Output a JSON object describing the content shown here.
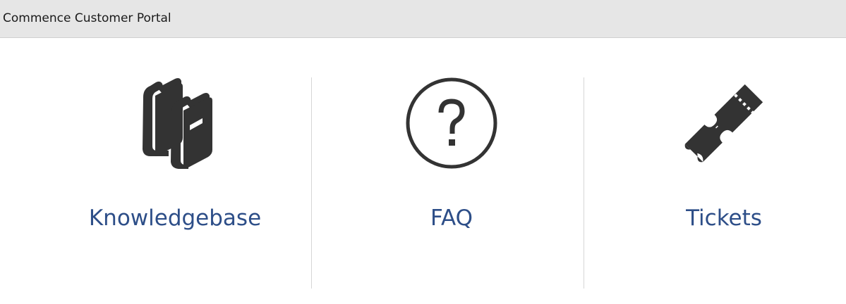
{
  "header": {
    "title": "Commence Customer Portal"
  },
  "tiles": [
    {
      "label": "Knowledgebase",
      "icon": "books-icon"
    },
    {
      "label": "FAQ",
      "icon": "question-circle-icon"
    },
    {
      "label": "Tickets",
      "icon": "ticket-icon"
    }
  ],
  "colors": {
    "header_bg": "#e6e6e6",
    "link": "#2d4e88",
    "icon": "#333333",
    "divider": "#d6d6d6"
  }
}
